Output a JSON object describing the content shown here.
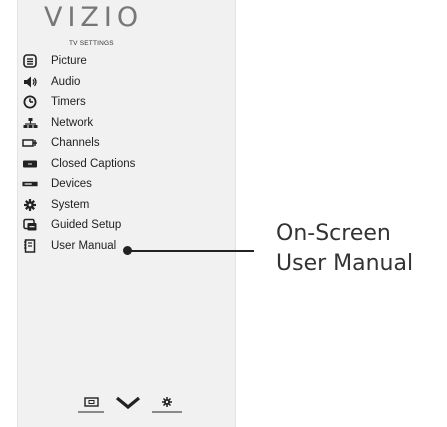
{
  "brand": {
    "logo_text": "VIZIO"
  },
  "menu": {
    "header": "TV SETTINGS",
    "items": [
      {
        "label": "Picture",
        "icon": "picture-icon"
      },
      {
        "label": "Audio",
        "icon": "audio-icon"
      },
      {
        "label": "Timers",
        "icon": "timer-icon"
      },
      {
        "label": "Network",
        "icon": "network-icon"
      },
      {
        "label": "Channels",
        "icon": "channels-icon"
      },
      {
        "label": "Closed Captions",
        "icon": "closed-captions-icon"
      },
      {
        "label": "Devices",
        "icon": "devices-icon"
      },
      {
        "label": "System",
        "icon": "system-gear-icon"
      },
      {
        "label": "Guided Setup",
        "icon": "guided-setup-icon"
      },
      {
        "label": "User Manual",
        "icon": "user-manual-icon"
      }
    ]
  },
  "bottom_nav": [
    {
      "icon": "input-icon"
    },
    {
      "icon": "vizio-v-icon"
    },
    {
      "icon": "settings-icon"
    }
  ],
  "callout": {
    "line1": "On-Screen",
    "line2": "User Manual"
  },
  "colors": {
    "panel_bg": "#f1f1f1",
    "logo": "#777777",
    "text": "#222222"
  }
}
